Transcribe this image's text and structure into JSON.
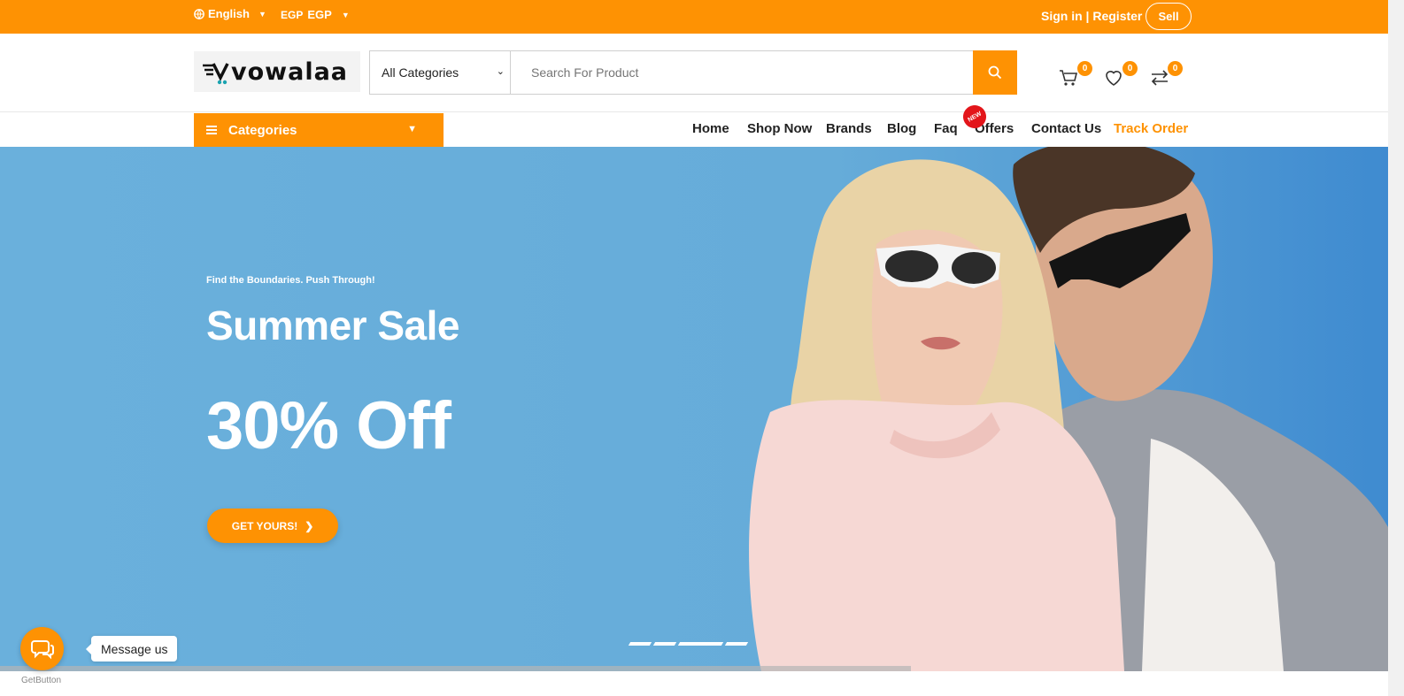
{
  "topbar": {
    "language": "English",
    "currency_code": "EGP",
    "currency_label": "EGP",
    "signin_label": "Sign in | Register",
    "sell_label": "Sell"
  },
  "header": {
    "logo_text": "vowalaa",
    "category_select": "All Categories",
    "search_placeholder": "Search For Product",
    "cart_count": "0",
    "wishlist_count": "0",
    "compare_count": "0"
  },
  "nav": {
    "categories_label": "Categories",
    "links": [
      "Home",
      "Shop Now",
      "Brands",
      "Blog",
      "Faq",
      "Offers",
      "Contact Us",
      "Track Order"
    ],
    "new_tag": "NEW"
  },
  "hero": {
    "tagline": "Find the Boundaries. Push Through!",
    "title": "Summer Sale",
    "discount": "30% Off",
    "cta": "GET YOURS!"
  },
  "chat": {
    "message_label": "Message us",
    "brand": "GetButton"
  },
  "colors": {
    "accent": "#fe9203",
    "hero_bg": "#6ab0dc",
    "new_badge": "#e3151a"
  }
}
